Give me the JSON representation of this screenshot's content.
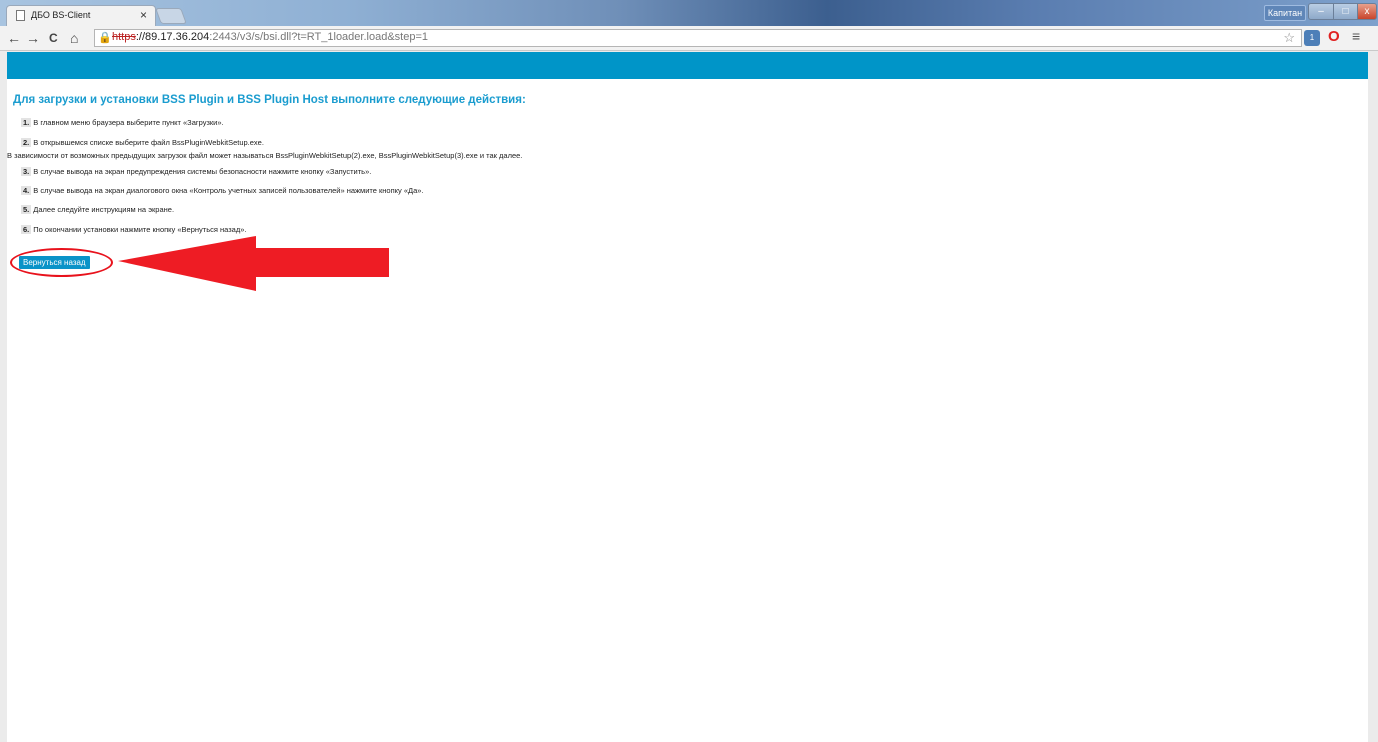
{
  "browser": {
    "tab_title": "ДБО BS-Client",
    "tab_close": "×",
    "user_name": "Капитан",
    "window_controls": {
      "minimize": "–",
      "maximize": "□",
      "close": "x"
    },
    "nav": {
      "back": "←",
      "forward": "→",
      "reload": "C",
      "home": "⌂"
    },
    "url_scheme": "https",
    "url_host": "://89.17.36.204",
    "url_path": ":2443/v3/s/bsi.dll?t=RT_1loader.load&step=1",
    "bookmark_star": "☆",
    "extension_badge": "1",
    "opera_icon": "O",
    "menu_icon": "≡",
    "accent_color": "#0095c8"
  },
  "page": {
    "heading": "Для загрузки и установки BSS Plugin и BSS Plugin Host выполните следующие действия:",
    "steps": [
      {
        "num": "1.",
        "text": "В главном меню браузера выберите пункт «Загрузки»."
      },
      {
        "num": "2.",
        "text": "В открывшемся списке выберите файл BssPluginWebkitSetup.exe."
      },
      {
        "num": "3.",
        "text": "В случае вывода на экран предупреждения системы безопасности нажмите кнопку «Запустить»."
      },
      {
        "num": "4.",
        "text": "В случае вывода на экран диалогового окна «Контроль учетных записей пользователей» нажмите кнопку «Да»."
      },
      {
        "num": "5.",
        "text": "Далее следуйте инструкциям на экране."
      },
      {
        "num": "6.",
        "text": "По окончании установки нажмите кнопку «Вернуться назад»."
      }
    ],
    "step2_note": "В зависимости от возможных предыдущих загрузок файл может называться BssPluginWebkitSetup(2).exe, BssPluginWebkitSetup(3).exe и так далее.",
    "back_button_label": "Вернуться назад",
    "annotation_color": "#e8121c"
  }
}
